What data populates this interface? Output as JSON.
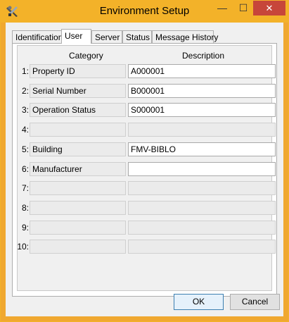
{
  "window": {
    "title": "Environment Setup",
    "minimize_glyph": "—",
    "maximize_glyph": "☐",
    "close_glyph": "✕"
  },
  "tabs": [
    {
      "label": "Identification",
      "active": false
    },
    {
      "label": "User",
      "active": true
    },
    {
      "label": "Server",
      "active": false
    },
    {
      "label": "Status",
      "active": false
    },
    {
      "label": "Message History",
      "active": false
    }
  ],
  "table": {
    "header_category": "Category",
    "header_description": "Description",
    "rows": [
      {
        "num": "1:",
        "category": "Property ID",
        "description": "A000001",
        "editable": true
      },
      {
        "num": "2:",
        "category": "Serial Number",
        "description": "B000001",
        "editable": true
      },
      {
        "num": "3:",
        "category": "Operation Status",
        "description": "S000001",
        "editable": true
      },
      {
        "num": "4:",
        "category": "",
        "description": "",
        "editable": false
      },
      {
        "num": "5:",
        "category": "Building",
        "description": "FMV-BIBLO",
        "editable": true
      },
      {
        "num": "6:",
        "category": "Manufacturer",
        "description": "",
        "editable": true
      },
      {
        "num": "7:",
        "category": "",
        "description": "",
        "editable": false
      },
      {
        "num": "8:",
        "category": "",
        "description": "",
        "editable": false
      },
      {
        "num": "9:",
        "category": "",
        "description": "",
        "editable": false
      },
      {
        "num": "10:",
        "category": "",
        "description": "",
        "editable": false
      }
    ]
  },
  "buttons": {
    "ok": "OK",
    "cancel": "Cancel"
  },
  "colors": {
    "title_bar": "#f3b229",
    "close_button": "#c7463a",
    "dialog_bg": "#f0f0f0"
  }
}
